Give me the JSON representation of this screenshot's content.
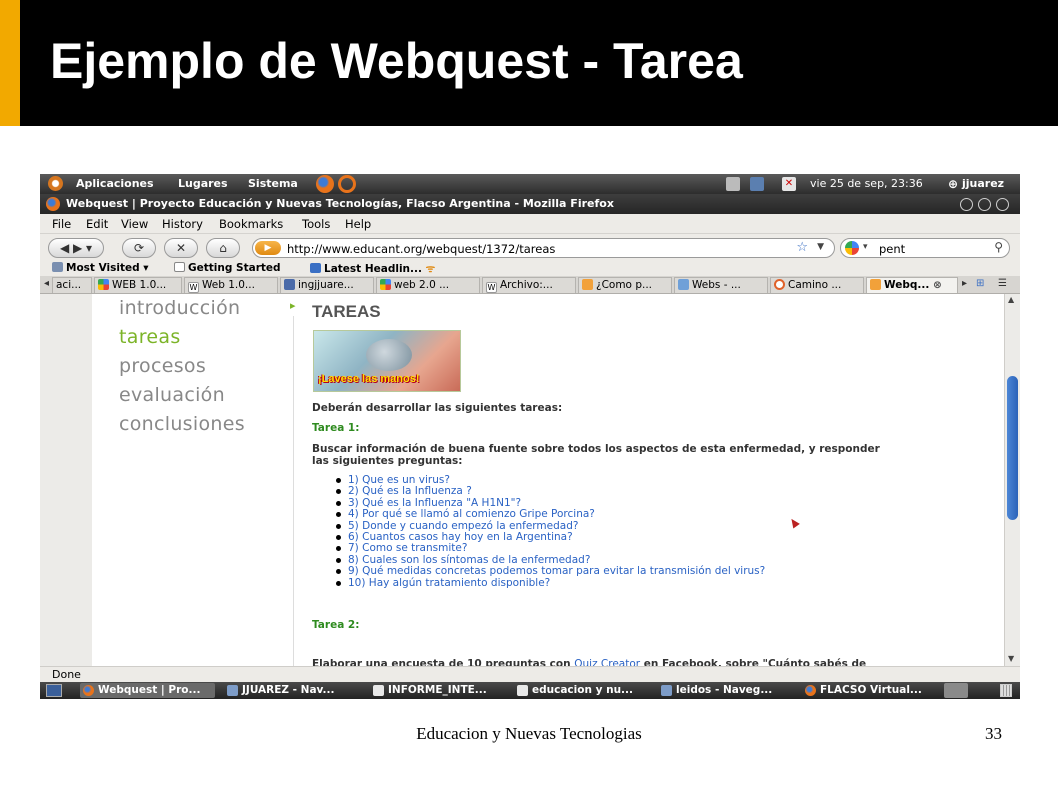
{
  "slide": {
    "title": "Ejemplo de Webquest - Tarea",
    "footer": "Educacion y Nuevas Tecnologias",
    "page_number": "33",
    "accent_color": "#f2a900"
  },
  "gnome_panel": {
    "menus": [
      "Aplicaciones",
      "Lugares",
      "Sistema"
    ],
    "clock": "vie 25 de sep, 23:36",
    "user": "jjuarez"
  },
  "window": {
    "title": "Webquest | Proyecto Educación y Nuevas Tecnologías, Flacso Argentina - Mozilla Firefox"
  },
  "menubar": {
    "items": [
      "File",
      "Edit",
      "View",
      "History",
      "Bookmarks",
      "Tools",
      "Help"
    ]
  },
  "navbar": {
    "url": "http://www.educant.org/webquest/1372/tareas",
    "search_value": "pent"
  },
  "bookmarks": {
    "items": [
      "Most Visited ▾",
      "Getting Started",
      "Latest Headlin..."
    ]
  },
  "tabs": [
    {
      "label": "aci..."
    },
    {
      "label": "WEB 1.0..."
    },
    {
      "label": "Web 1.0..."
    },
    {
      "label": "ingjjuare..."
    },
    {
      "label": "web 2.0 ..."
    },
    {
      "label": "Archivo:..."
    },
    {
      "label": "¿Como p..."
    },
    {
      "label": "Webs - ..."
    },
    {
      "label": "Camino ..."
    },
    {
      "label": "Webq..."
    }
  ],
  "page": {
    "nav": [
      "introducción",
      "tareas",
      "procesos",
      "evaluación",
      "conclusiones"
    ],
    "heading": "TAREAS",
    "hero_caption": "¡Lavese las manos!",
    "intro": "Deberán desarrollar las siguientes tareas:",
    "task1_label": "Tarea 1:",
    "task1_text_line1": "Buscar información de buena fuente sobre todos los aspectos de esta enfermedad, y responder",
    "task1_text_line2": "las siguientes preguntas:",
    "questions": [
      "1) Que es un virus?",
      "2) Qué es la Influenza ?",
      "3) Qué es la Influenza \"A H1N1\"?",
      "4) Por qué se llamó al comienzo Gripe Porcina?",
      "5) Donde y cuando empezó la enfermedad?",
      "6) Cuantos casos hay hoy en la Argentina?",
      "7) Como se transmite?",
      "8) Cuales son los síntomas de la enfermedad?",
      "9) Qué medidas concretas podemos tomar para evitar la transmisión del virus?",
      "10) Hay algún tratamiento disponible?"
    ],
    "task2_label": "Tarea 2:",
    "task2_text_start": "Elaborar una encuesta de 10 preguntas con ",
    "task2_link": "Quiz Creator",
    "task2_text_end": " en Facebook, sobre \"Cuánto sabés de"
  },
  "statusbar": {
    "text": "Done"
  },
  "taskbar": {
    "items": [
      "Webquest | Pro...",
      "JJUAREZ - Nav...",
      "INFORME_INTE...",
      "educacion y nu...",
      "leidos - Naveg...",
      "FLACSO Virtual..."
    ]
  },
  "colors": {
    "nav_active": "#7cb428",
    "task_label": "#2e8b1f",
    "link": "#2a62c4"
  }
}
